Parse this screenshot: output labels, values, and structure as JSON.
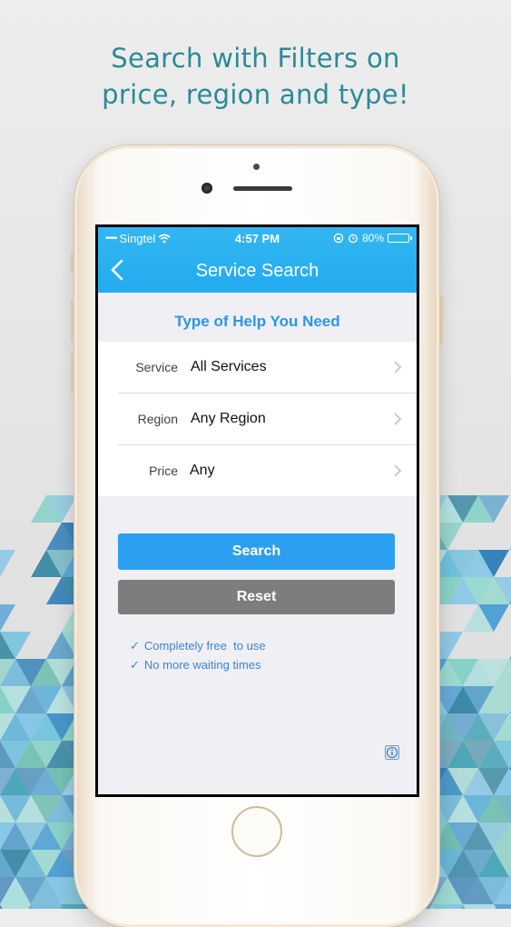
{
  "headline": {
    "line1": "Search with Filters on",
    "line2": "price, region and type!"
  },
  "status_bar": {
    "dots": "•••••",
    "carrier": "Singtel",
    "time": "4:57 PM",
    "battery": "80%"
  },
  "nav": {
    "title": "Service Search"
  },
  "section_title": "Type of Help You Need",
  "filters": [
    {
      "label": "Service",
      "value": "All Services"
    },
    {
      "label": "Region",
      "value": "Any Region"
    },
    {
      "label": "Price",
      "value": "Any"
    }
  ],
  "buttons": {
    "search": "Search",
    "reset": "Reset"
  },
  "features": [
    {
      "check": "✓",
      "text": "Completely free  to use"
    },
    {
      "check": "✓",
      "text": "No more waiting times"
    }
  ],
  "colors": {
    "accent": "#2d9ff0",
    "nav_bar": "#23abef",
    "reset_button": "#7d7d7d",
    "headline": "#2b8a96"
  },
  "icons": [
    "back-chevron-icon",
    "wifi-icon",
    "alarm-icon",
    "battery-icon",
    "chevron-right-icon",
    "info-icon"
  ]
}
